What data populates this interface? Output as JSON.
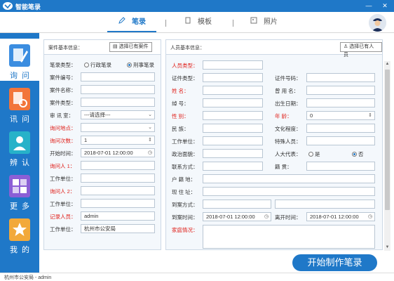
{
  "app": {
    "title": "智能笔录"
  },
  "window": {
    "minimize": "—",
    "close": "✕"
  },
  "tabs": [
    {
      "label": "笔录",
      "icon": "pencil-icon"
    },
    {
      "label": "模板",
      "icon": "document-icon"
    },
    {
      "label": "照片",
      "icon": "photo-icon"
    }
  ],
  "sidebar": [
    {
      "label": "询问",
      "icon": "notepad-pen-icon"
    },
    {
      "label": "讯问",
      "icon": "clipboard-search-icon"
    },
    {
      "label": "辨认",
      "icon": "person-scan-icon"
    },
    {
      "label": "更多",
      "icon": "grid-apps-icon"
    },
    {
      "label": "我的",
      "icon": "star-icon"
    }
  ],
  "case": {
    "title": "案件基本信息：",
    "select_button": "选择已有案件",
    "record_type_label": "笔录类型：",
    "record_type_options": [
      "行政笔录",
      "刑事笔录"
    ],
    "record_type_selected": 1,
    "fields": [
      {
        "label": "案件编号：",
        "value": "",
        "red": false
      },
      {
        "label": "案件名称：",
        "value": "",
        "red": false
      },
      {
        "label": "案件类型：",
        "value": "",
        "red": false
      },
      {
        "label": "审 讯 室：",
        "value": "---请选择---",
        "red": false,
        "dropdown": true
      },
      {
        "label": "询问地点：",
        "value": "",
        "red": true,
        "dropdown": true
      },
      {
        "label": "询问次数：",
        "value": "1",
        "red": true,
        "stepper": true
      },
      {
        "label": "开始时间：",
        "value": "2018-07-01  12:00:00",
        "red": false,
        "clock": true
      },
      {
        "label": "询问人 1：",
        "value": "",
        "red": true
      },
      {
        "label": "工作单位：",
        "value": "",
        "red": false
      },
      {
        "label": "询问人 2：",
        "value": "",
        "red": true
      },
      {
        "label": "工作单位：",
        "value": "",
        "red": false
      },
      {
        "label": "记录人员：",
        "value": "admin",
        "red": true
      },
      {
        "label": "工作单位：",
        "value": "杭州市公安局",
        "red": false
      }
    ]
  },
  "person": {
    "title": "人员基本信息：",
    "select_button": "选择已有人员",
    "type_label": "人员类型：",
    "id_type_label": "证件类型：",
    "id_no_label": "证件号码：",
    "name_label": "姓     名：",
    "alias_label": "曾 用 名：",
    "nickname_label": "绰     号：",
    "birth_label": "出生日期：",
    "gender_label": "性     别：",
    "age_label": "年     龄：",
    "age_value": "0",
    "ethnicity_label": "民     族：",
    "education_label": "文化程度：",
    "employer_label": "工作单位：",
    "special_label": "特殊人员：",
    "political_label": "政治面貌：",
    "npc_label": "人大代表：",
    "npc_options": [
      "是",
      "否"
    ],
    "npc_selected": 1,
    "contact_label": "联系方式：",
    "native_label": "籍     贯：",
    "household_label": "户 籍 地：",
    "address_label": "现 住 址：",
    "arrival_label": "到案方式：",
    "arrival_time_label": "到案时间：",
    "arrival_time_value": "2018-07-01  12:00:00",
    "leave_time_label": "离开时间：",
    "leave_time_value": "2018-07-01  12:00:00",
    "family_label": "家庭情况："
  },
  "actions": {
    "start_button": "开始制作笔录"
  },
  "status": {
    "text": "杭州市公安局 - admin"
  },
  "colors": {
    "primary": "#1f78c8",
    "required": "#e0201a"
  }
}
